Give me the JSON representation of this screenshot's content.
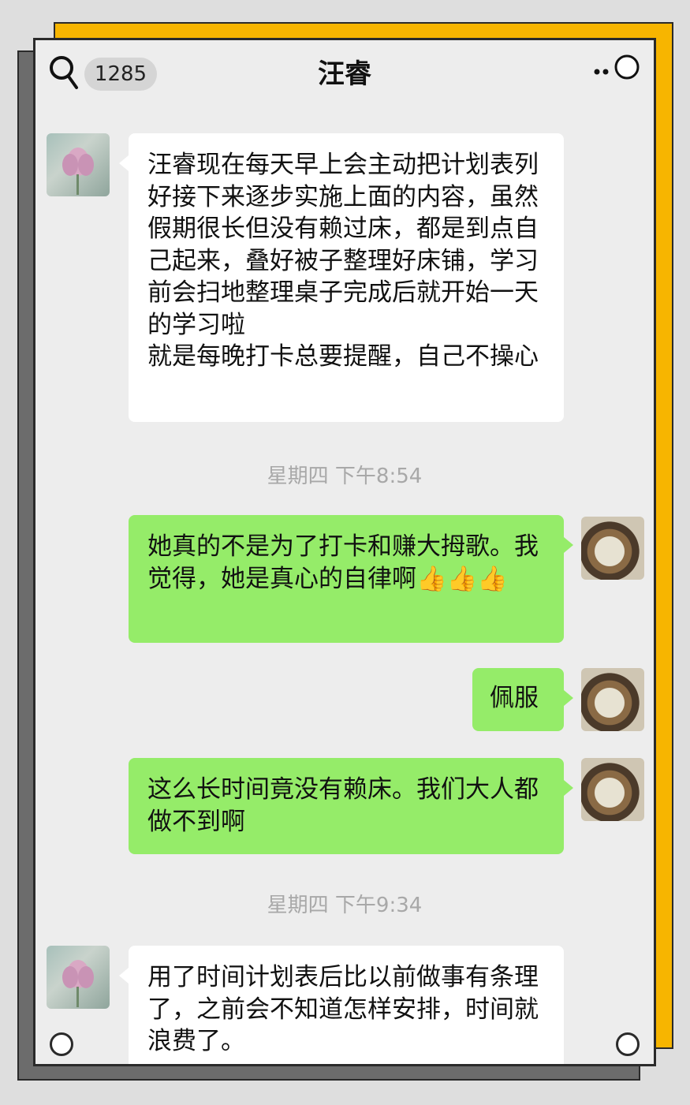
{
  "header": {
    "unread_count": "1285",
    "contact_name": "汪睿",
    "icons": [
      "search-icon",
      "more-icon"
    ]
  },
  "messages": [
    {
      "side": "in",
      "text": "汪睿现在每天早上会主动把计划表列好接下来逐步实施上面的内容，虽然假期很长但没有赖过床，都是到点自己起来，叠好被子整理好床铺，学习前会扫地整理桌子完成后就开始一天的学习啦\n就是每晚打卡总要提醒，自己不操心"
    },
    {
      "timestamp": "星期四 下午8:54"
    },
    {
      "side": "out",
      "text": "她真的不是为了打卡和赚大拇歌。我觉得，她是真心的自律啊👍👍👍"
    },
    {
      "side": "out",
      "text": "佩服"
    },
    {
      "side": "out",
      "text": "这么长时间竟没有赖床。我们大人都做不到啊"
    },
    {
      "timestamp": "星期四 下午9:34"
    },
    {
      "side": "in",
      "text": "用了时间计划表后比以前做事有条理了，之前会不知道怎样安排，时间就浪费了。"
    }
  ],
  "colors": {
    "incoming_bubble": "#ffffff",
    "outgoing_bubble": "#95ec69",
    "chat_background": "#ededed",
    "frame_accent": "#f7b500"
  }
}
